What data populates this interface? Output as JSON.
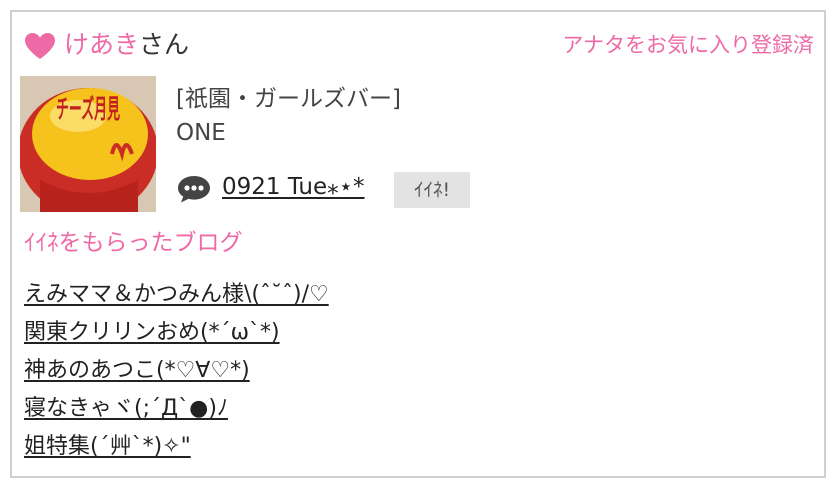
{
  "header": {
    "user_name": "けあき",
    "user_suffix": "さん",
    "favorite_status": "アナタをお気に入り登録済"
  },
  "shop": {
    "category": "[祇園・ガールズバー]",
    "girl_name": "ONE",
    "thumbnail_text": "チーズ月見"
  },
  "entry": {
    "title": "0921 Tue⁎⋆*",
    "iine_label": "ｲｲﾈ!"
  },
  "blogs": {
    "section_title": "ｲｲﾈをもらったブログ",
    "items": [
      "えみママ＆かつみん様\\(ˆ˘ˆ)/♡",
      "関東クリリンおめ(*´ω`*)",
      "神あのあつこ(*♡∀♡*)",
      "寝なきゃヾ(;´Д`●)ﾉ",
      "姐特集(´艸`*)✧\""
    ]
  },
  "colors": {
    "accent_pink": "#ee6aa7",
    "text": "#222222",
    "button_bg": "#e3e3e3",
    "border": "#cfcfcf"
  },
  "icons": {
    "favorite": "heart-icon",
    "comment": "speech-bubble-icon"
  }
}
